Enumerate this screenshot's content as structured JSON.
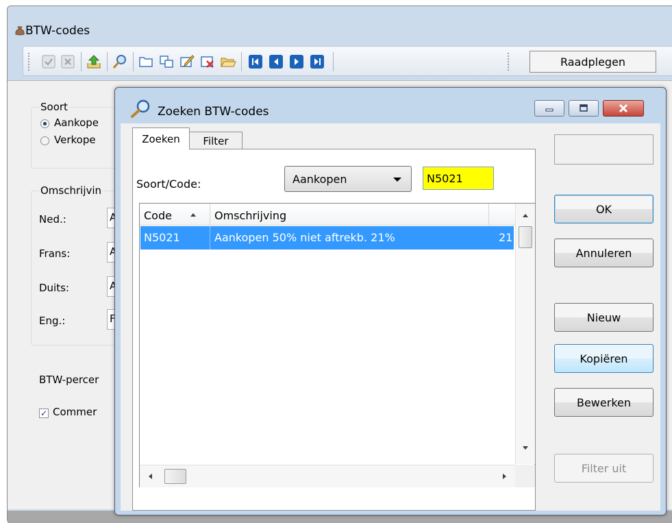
{
  "main_window": {
    "title": "BTW-codes",
    "toolbar": {
      "icons": [
        "confirm-icon",
        "cancel-icon",
        "export-icon",
        "search-icon",
        "new-icon",
        "copy-icon",
        "edit-icon",
        "delete-icon",
        "open-folder-icon",
        "first-record-icon",
        "previous-record-icon",
        "next-record-icon",
        "last-record-icon"
      ],
      "mode_label": "Raadplegen"
    },
    "soort": {
      "group_title": "Soort",
      "options": [
        "Aankope",
        "Verkope"
      ],
      "selected": "Aankope"
    },
    "omschrijving": {
      "group_title": "Omschrijvin",
      "rows": [
        {
          "label": "Ned.:",
          "value": "A"
        },
        {
          "label": "Frans:",
          "value": "A"
        },
        {
          "label": "Duits:",
          "value": "A"
        },
        {
          "label": "Eng.:",
          "value": "F"
        }
      ]
    },
    "btw_label": "BTW-percer",
    "commentaar_label": "Commer",
    "commentaar_checked": true
  },
  "dialog": {
    "title": "Zoeken BTW-codes",
    "tabs": [
      {
        "label": "Zoeken",
        "active": true
      },
      {
        "label": "Filter",
        "active": false
      }
    ],
    "soort_code_label": "Soort/Code:",
    "soort_select_value": "Aankopen",
    "code_input_value": "N5021",
    "code_input_bg": "#ffff00",
    "grid": {
      "columns": [
        "Code",
        "Omschrijving",
        ""
      ],
      "sort_column": "Code",
      "sort_direction": "ascending",
      "rows": [
        {
          "code": "N5021",
          "omschrijving": "Aankopen 50% niet aftrekb. 21%",
          "extra": "21",
          "selected": true
        }
      ],
      "selection_color": "#3399ff"
    },
    "buttons": {
      "ok": "OK",
      "annuleren": "Annuleren",
      "nieuw": "Nieuw",
      "kopieren": "Kopiëren",
      "bewerken": "Bewerken",
      "filter_uit": "Filter uit"
    }
  }
}
